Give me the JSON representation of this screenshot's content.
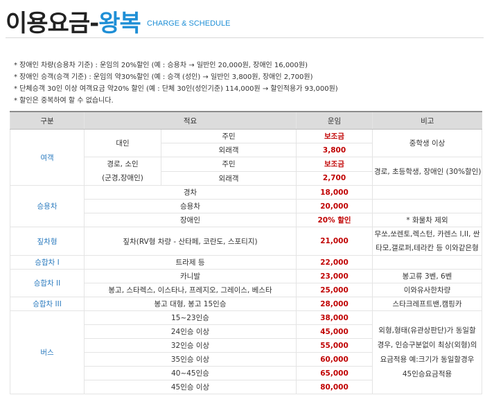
{
  "header": {
    "title_main": "이용요금-",
    "title_accent": "왕복",
    "subtitle": "CHARGE & SCHEDULE"
  },
  "notes": [
    "* 장애인 차량(승용차 기준) : 운임의 20%할인 (예 : 승용차 → 일반인 20,000원, 장애인 16,000원)",
    "* 장애인 승객(승객 기준) : 운임의 약30%할인 (예 : 승객 (성인) → 일반인 3,800원, 장애인 2,700원)",
    "* 단체승객 30인 이상 여객요금 약20% 할인 (예 : 단체 30인(성인기준) 114,000원 → 할인적용가 93,000원)",
    "* 할인은 중복하여 할 수 없습니다."
  ],
  "table": {
    "headers": [
      "구분",
      "적요",
      "운임",
      "비고"
    ],
    "passenger": {
      "category": "여객",
      "adult": "대인",
      "resident": "주민",
      "visitor": "외래객",
      "subsidy": "보조금",
      "adult_visitor_fare": "3,800",
      "adult_note": "중학생 이상",
      "senior_line1": "경로, 소인",
      "senior_line2": "(군경,장애인)",
      "senior_resident": "주민",
      "senior_subsidy": "보조금",
      "senior_visitor": "외래객",
      "senior_visitor_fare": "2,700",
      "senior_note": "경로, 초등학생, 장애인 (30%할인)"
    },
    "car": {
      "category": "승용차",
      "rows": [
        {
          "label": "경차",
          "fare": "18,000"
        },
        {
          "label": "승용차",
          "fare": "20,000"
        },
        {
          "label": "장애인",
          "fare": "20% 할인"
        }
      ],
      "note": "* 화물차 제외"
    },
    "rv": {
      "category": "짚차형",
      "label": "짚차(RV형 차량 - 산타페, 코란도, 스포티지)",
      "fare": "21,000",
      "note": "무쏘,쏘렌토,렉스턴, 카렌스 I,II, 싼타모,갤로퍼,테라칸 등 이와같은형"
    },
    "van1": {
      "category": "승합차 I",
      "label": "트라제 등",
      "fare": "22,000"
    },
    "van2": {
      "category": "승합차 II",
      "rows": [
        {
          "label": "카니발",
          "fare": "23,000",
          "note": "봉고류 3벤, 6벤"
        },
        {
          "label": "봉고, 스타렉스, 이스타나, 프레지오, 그레이스, 베스타",
          "fare": "25,000",
          "note": "이와유사한차량"
        }
      ]
    },
    "van3": {
      "category": "승합차 III",
      "label": "봉고 대형, 봉고 15인승",
      "fare": "28,000",
      "note": "스타크레프트밴,캠핑카"
    },
    "bus": {
      "category": "버스",
      "rows": [
        {
          "label": "15~23인승",
          "fare": "38,000"
        },
        {
          "label": "24인승 이상",
          "fare": "45,000"
        },
        {
          "label": "32인승 이상",
          "fare": "55,000"
        },
        {
          "label": "35인승 이상",
          "fare": "60,000"
        },
        {
          "label": "40~45인승",
          "fare": "65,000"
        },
        {
          "label": "45인승 이상",
          "fare": "80,000"
        }
      ],
      "note": "외형,형태(유관상판단)가 동일할 경우, 인승구분없이 최상(외형)의 요금적용 예:크기가 동일할경우 45인승요금적용"
    }
  }
}
